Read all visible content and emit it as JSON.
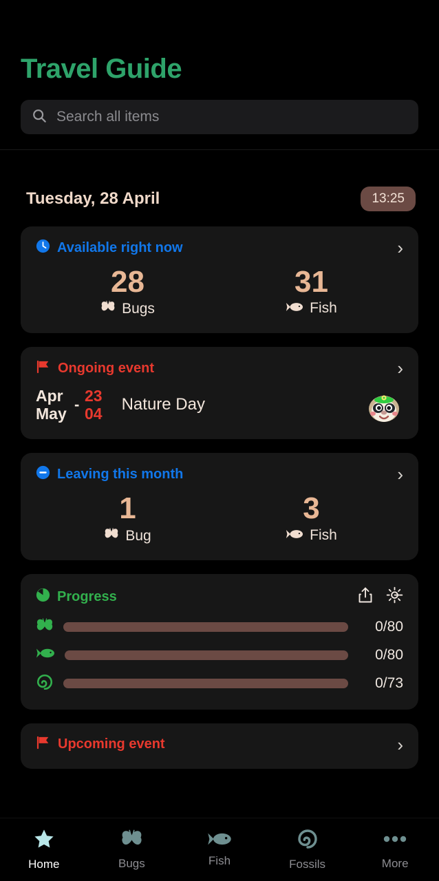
{
  "header": {
    "title": "Travel Guide",
    "search": {
      "placeholder": "Search all items",
      "value": "",
      "icon": "search-icon"
    }
  },
  "date_row": {
    "date": "Tuesday, 28 April",
    "time": "13:25"
  },
  "cards": {
    "available": {
      "icon": "clock-icon",
      "title": "Available right now",
      "chevron": "›",
      "stats": [
        {
          "value": "28",
          "label": "Bugs",
          "icon": "bug-icon"
        },
        {
          "value": "31",
          "label": "Fish",
          "icon": "fish-icon"
        }
      ]
    },
    "ongoing": {
      "icon": "flag-icon",
      "title": "Ongoing event",
      "chevron": "›",
      "start_month": "Apr",
      "start_day": "23",
      "end_month": "May",
      "end_day": "04",
      "dash": "-",
      "name": "Nature Day",
      "avatar": "sloth-avatar"
    },
    "leaving": {
      "icon": "minus-circle-icon",
      "title": "Leaving this month",
      "chevron": "›",
      "stats": [
        {
          "value": "1",
          "label": "Bug",
          "icon": "bug-icon"
        },
        {
          "value": "3",
          "label": "Fish",
          "icon": "fish-icon"
        }
      ]
    },
    "progress": {
      "icon": "pie-chart-icon",
      "title": "Progress",
      "share_icon": "share-icon",
      "settings_icon": "gear-icon",
      "rows": [
        {
          "icon": "bug-icon",
          "value": "0/80",
          "caught": 0,
          "total": 80,
          "percent": 0
        },
        {
          "icon": "fish-icon",
          "value": "0/80",
          "caught": 0,
          "total": 80,
          "percent": 0
        },
        {
          "icon": "fossil-icon",
          "value": "0/73",
          "caught": 0,
          "total": 73,
          "percent": 0
        }
      ]
    },
    "upcoming": {
      "icon": "flag-icon",
      "title": "Upcoming event",
      "chevron": "›"
    }
  },
  "bottom_nav": [
    {
      "label": "Home",
      "icon": "star-icon",
      "active": true
    },
    {
      "label": "Bugs",
      "icon": "bug-icon",
      "active": false
    },
    {
      "label": "Fish",
      "icon": "fish-icon",
      "active": false
    },
    {
      "label": "Fossils",
      "icon": "fossil-icon",
      "active": false
    },
    {
      "label": "More",
      "icon": "ellipsis-icon",
      "active": false
    }
  ],
  "colors": {
    "brand_green": "#2ea36a",
    "accent_blue": "#1177ea",
    "accent_red": "#e8392e",
    "accent_green": "#32b04d",
    "tan": "#e8b795",
    "cream": "#f2e6dc",
    "pill_brown": "#6b4a44",
    "card_bg": "#171717",
    "nav_active": "#b8e6e8",
    "nav_inactive": "#6e8f90"
  }
}
